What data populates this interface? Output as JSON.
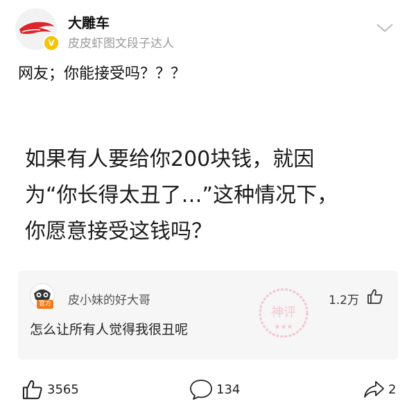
{
  "header": {
    "username": "大雕车",
    "subtitle": "皮皮虾图文段子达人",
    "verified_symbol": "V"
  },
  "post": {
    "caption": "网友；你能接受吗？？？",
    "image_text_lines": [
      "如果有人要给你200块钱，就因",
      "为“你长得太丑了…”这种情况下，",
      "你愿意接受这钱吗？"
    ]
  },
  "comment": {
    "author": "皮小妹的好大哥",
    "badge": "官方",
    "likes": "1.2万",
    "text": "怎么让所有人觉得我很丑呢",
    "stamp": "神评"
  },
  "actions": {
    "likes": "3565",
    "comments": "134",
    "shares": "2"
  },
  "colors": {
    "accent_red": "#d9262c",
    "verified_yellow": "#f5c400",
    "muted_text": "#999999",
    "comment_bg": "#f6f6f6",
    "stamp_pink": "#f0a0b0"
  }
}
